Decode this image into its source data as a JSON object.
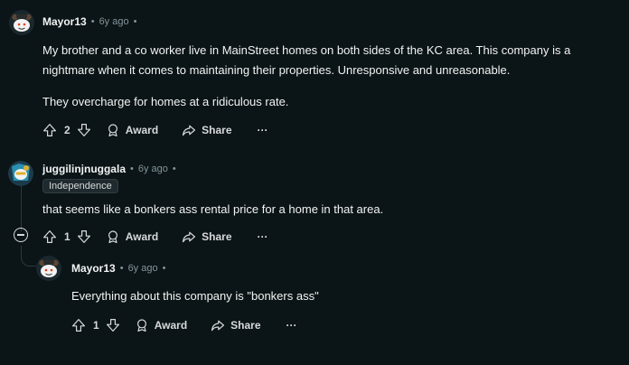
{
  "comments": [
    {
      "username": "Mayor13",
      "age": "6y ago",
      "paragraphs": [
        "My brother and a co worker live in MainStreet homes on both sides of the KC area. This company is a nightmare when it comes to maintaining their properties. Unresponsive and unreasonable.",
        "They overcharge for homes at a ridiculous rate."
      ],
      "votes": "2",
      "award_label": "Award",
      "share_label": "Share",
      "more_label": "···"
    },
    {
      "username": "juggilinjnuggala",
      "age": "6y ago",
      "flair": "Independence",
      "paragraphs": [
        "that seems like a bonkers ass rental price for a home in that area."
      ],
      "votes": "1",
      "award_label": "Award",
      "share_label": "Share",
      "more_label": "···"
    },
    {
      "username": "Mayor13",
      "age": "6y ago",
      "paragraphs": [
        "Everything about this company is \"bonkers ass\""
      ],
      "votes": "1",
      "award_label": "Award",
      "share_label": "Share",
      "more_label": "···"
    }
  ],
  "separator": "•",
  "icons": [
    "upvote-icon",
    "downvote-icon",
    "award-icon",
    "share-icon",
    "collapse-icon"
  ]
}
